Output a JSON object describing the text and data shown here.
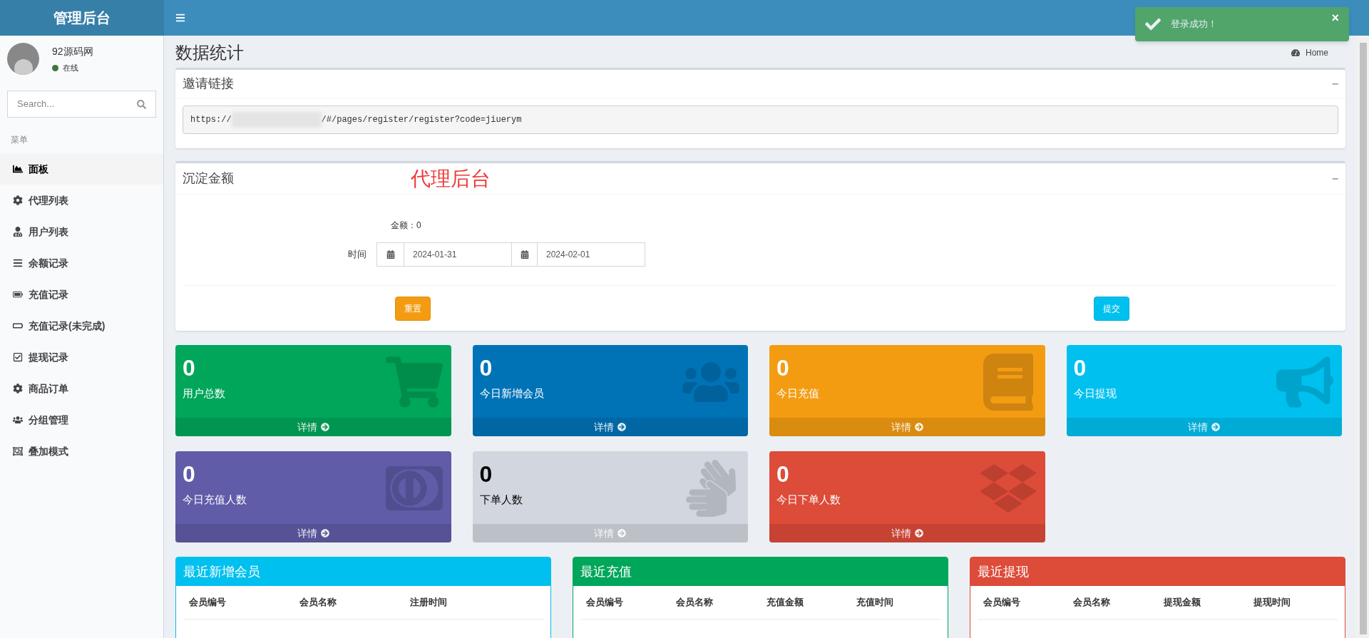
{
  "brand": "管理后台",
  "toast": {
    "message": "登录成功！",
    "close": "×"
  },
  "user": {
    "name": "92源码网",
    "status": "在线"
  },
  "search": {
    "placeholder": "Search..."
  },
  "menu_header": "菜单",
  "menu": [
    {
      "label": "面板",
      "selected": true
    },
    {
      "label": "代理列表",
      "selected": false
    },
    {
      "label": "用户列表",
      "selected": false
    },
    {
      "label": "余额记录",
      "selected": false
    },
    {
      "label": "充值记录",
      "selected": false
    },
    {
      "label": "充值记录(未完成)",
      "selected": false
    },
    {
      "label": "提现记录",
      "selected": false
    },
    {
      "label": "商品订单",
      "selected": false
    },
    {
      "label": "分组管理",
      "selected": false
    },
    {
      "label": "叠加模式",
      "selected": false
    }
  ],
  "page_title": "数据统计",
  "breadcrumb": "Home",
  "invite": {
    "title": "邀请链接",
    "collapse": "−",
    "link_start": "https://",
    "link_end": "/#/pages/register/register?code=jiuerym"
  },
  "balance": {
    "title": "沉淀金额",
    "collapse": "−",
    "annotation": "代理后台",
    "amount_label": "金额：",
    "amount": "0",
    "time_label": "时间",
    "date_from": "2024-01-31",
    "date_to": "2024-02-01",
    "reset": "重置",
    "submit": "提交"
  },
  "tiles": [
    {
      "value": "0",
      "label": "用户总数",
      "more": "详情",
      "color": "#00a65a"
    },
    {
      "value": "0",
      "label": "今日新增会员",
      "more": "详情",
      "color": "#0073b7"
    },
    {
      "value": "0",
      "label": "今日充值",
      "more": "详情",
      "color": "#f39c12"
    },
    {
      "value": "0",
      "label": "今日提现",
      "more": "详情",
      "color": "#00c0ef"
    },
    {
      "value": "0",
      "label": "今日充值人数",
      "more": "详情",
      "color": "#605ca8"
    },
    {
      "value": "0",
      "label": "下单人数",
      "more": "详情",
      "color": "#d2d6de"
    },
    {
      "value": "0",
      "label": "今日下单人数",
      "more": "详情",
      "color": "#dd4b39"
    }
  ],
  "tables": [
    {
      "title": "最近新增会员",
      "color": "#00c0ef",
      "columns": [
        "会员编号",
        "会员名称",
        "注册时间"
      ]
    },
    {
      "title": "最近充值",
      "color": "#00a65a",
      "columns": [
        "会员编号",
        "会员名称",
        "充值金额",
        "充值时间"
      ]
    },
    {
      "title": "最近提现",
      "color": "#dd4b39",
      "columns": [
        "会员编号",
        "会员名称",
        "提现金额",
        "提现时间"
      ]
    }
  ]
}
